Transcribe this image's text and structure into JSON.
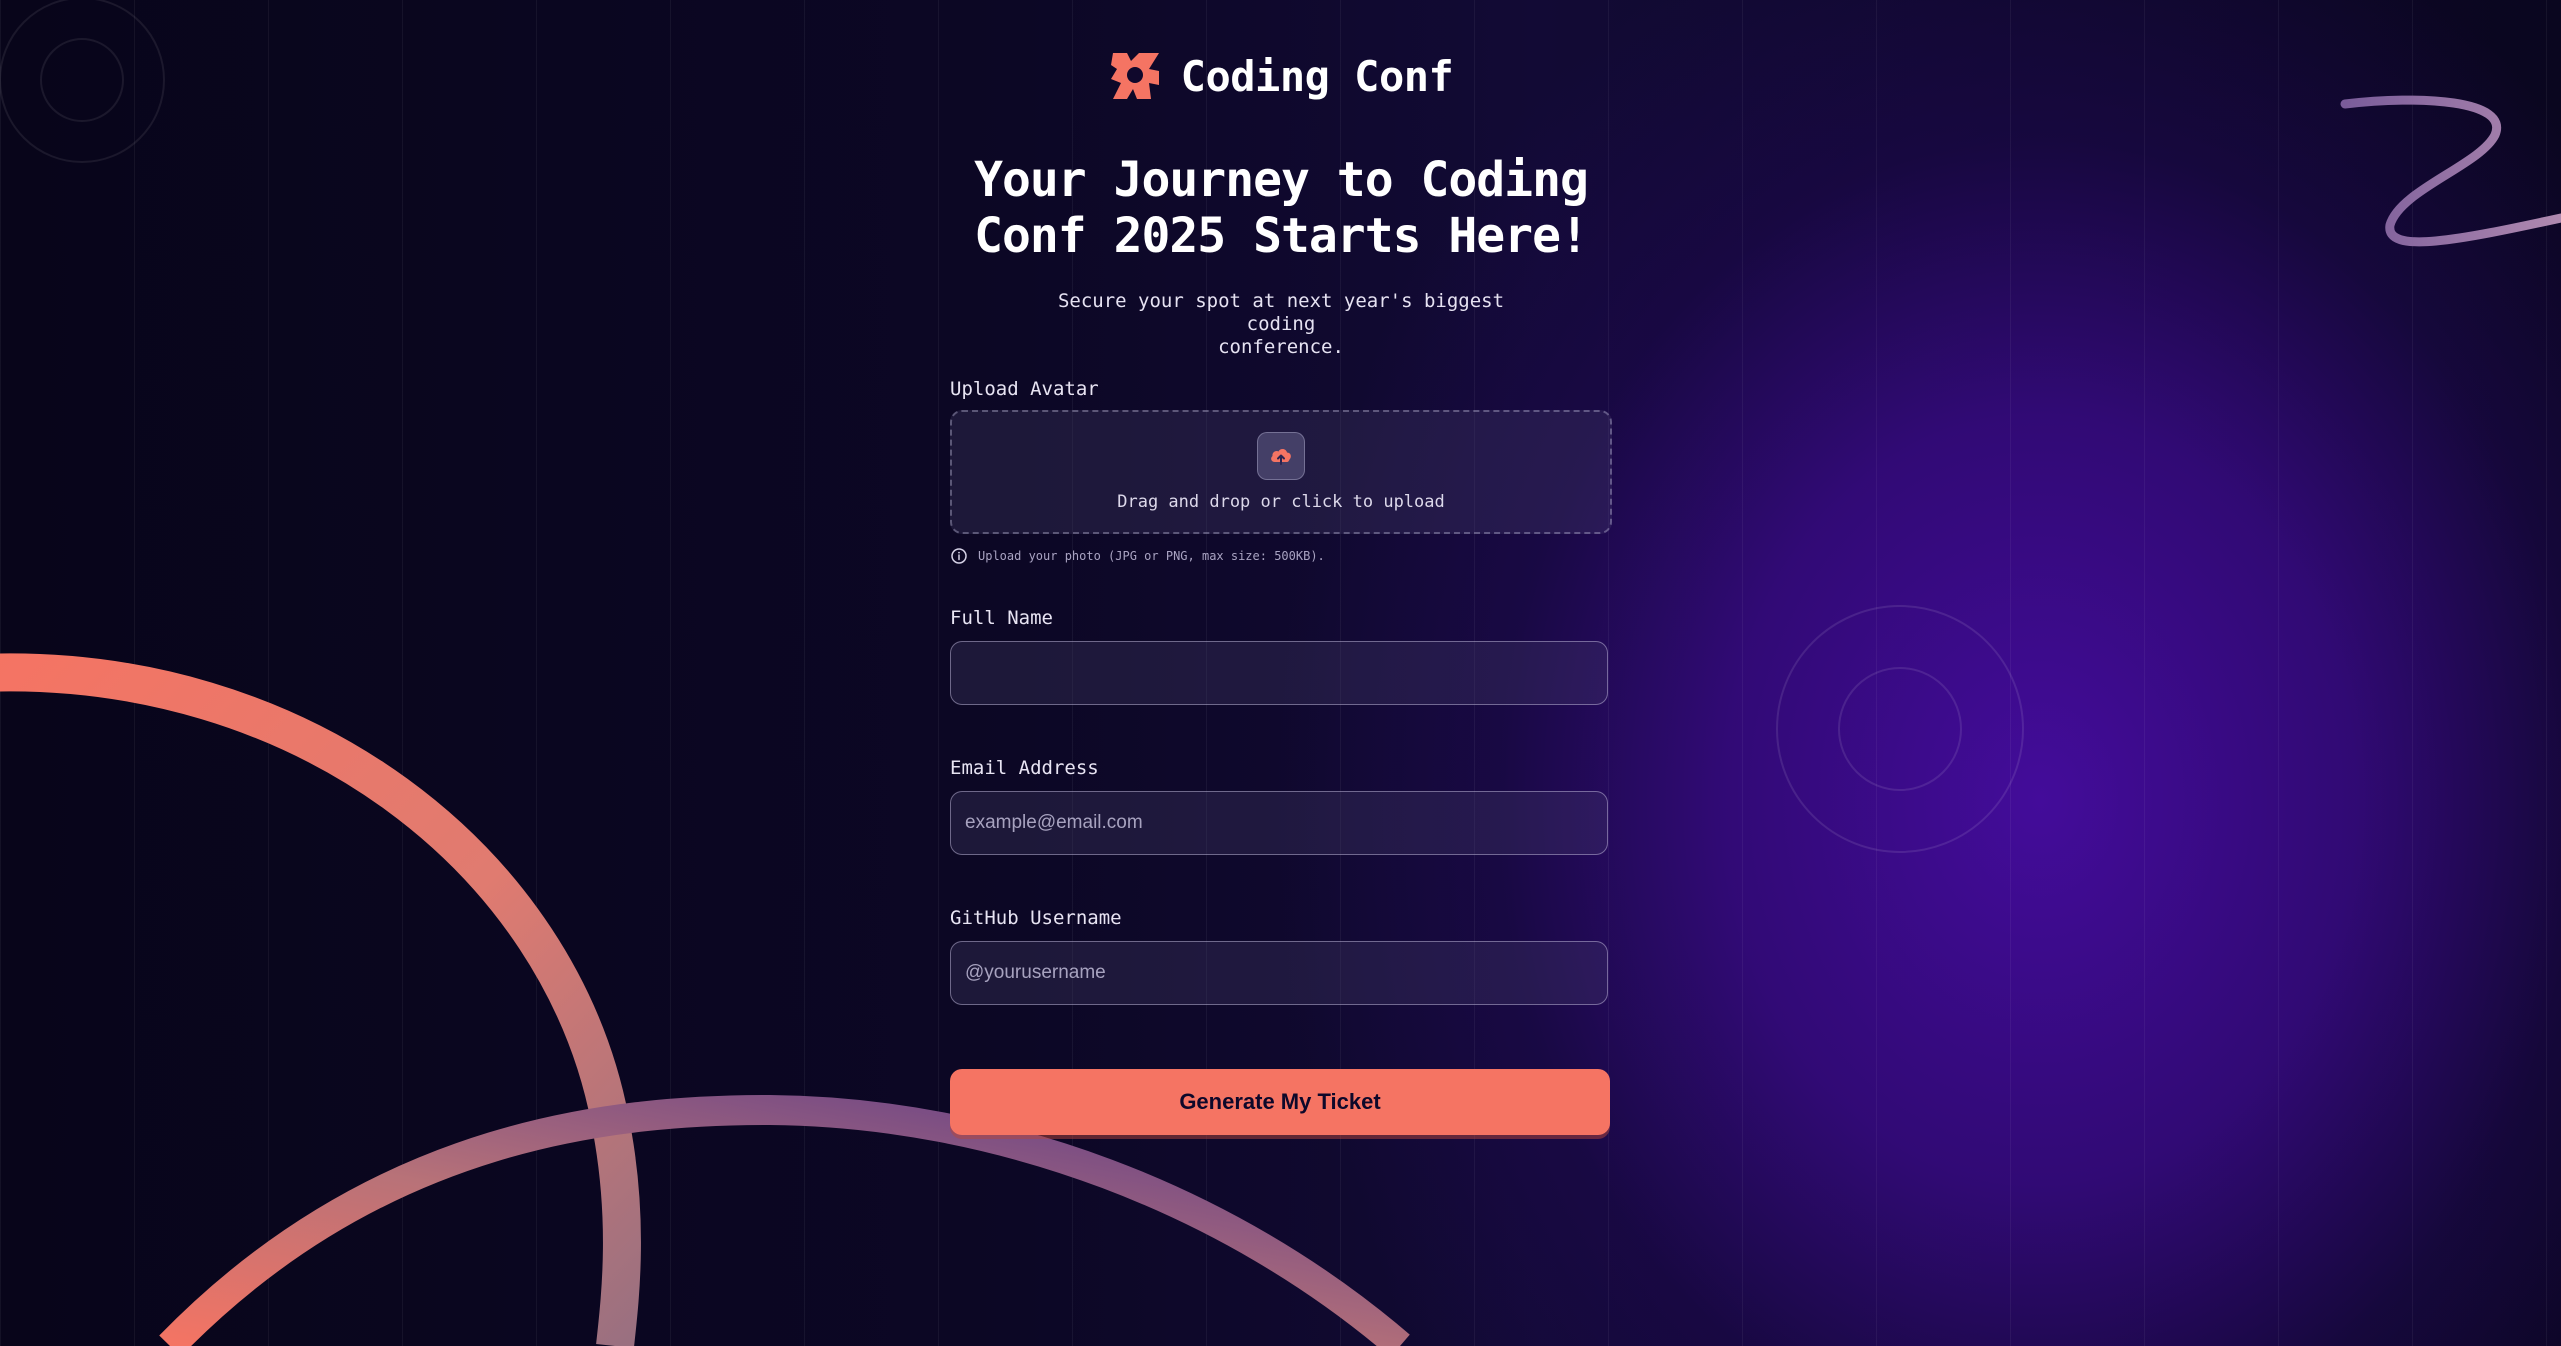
{
  "brand": {
    "name": "Coding Conf",
    "accent_color": "#f57463"
  },
  "hero": {
    "title_line1": "Your Journey to Coding",
    "title_line2": "Conf 2025 Starts Here!",
    "subtitle_line1": "Secure your spot at next year's biggest coding",
    "subtitle_line2": "conference."
  },
  "form": {
    "avatar": {
      "label": "Upload Avatar",
      "dropzone_text": "Drag and drop or click to upload",
      "hint": "Upload your photo (JPG or PNG, max size: 500KB).",
      "icon": "upload-cloud-icon"
    },
    "full_name": {
      "label": "Full Name",
      "value": "",
      "placeholder": ""
    },
    "email": {
      "label": "Email Address",
      "value": "",
      "placeholder": "example@email.com"
    },
    "github": {
      "label": "GitHub Username",
      "value": "",
      "placeholder": "@yourusername"
    },
    "submit_label": "Generate My Ticket"
  }
}
